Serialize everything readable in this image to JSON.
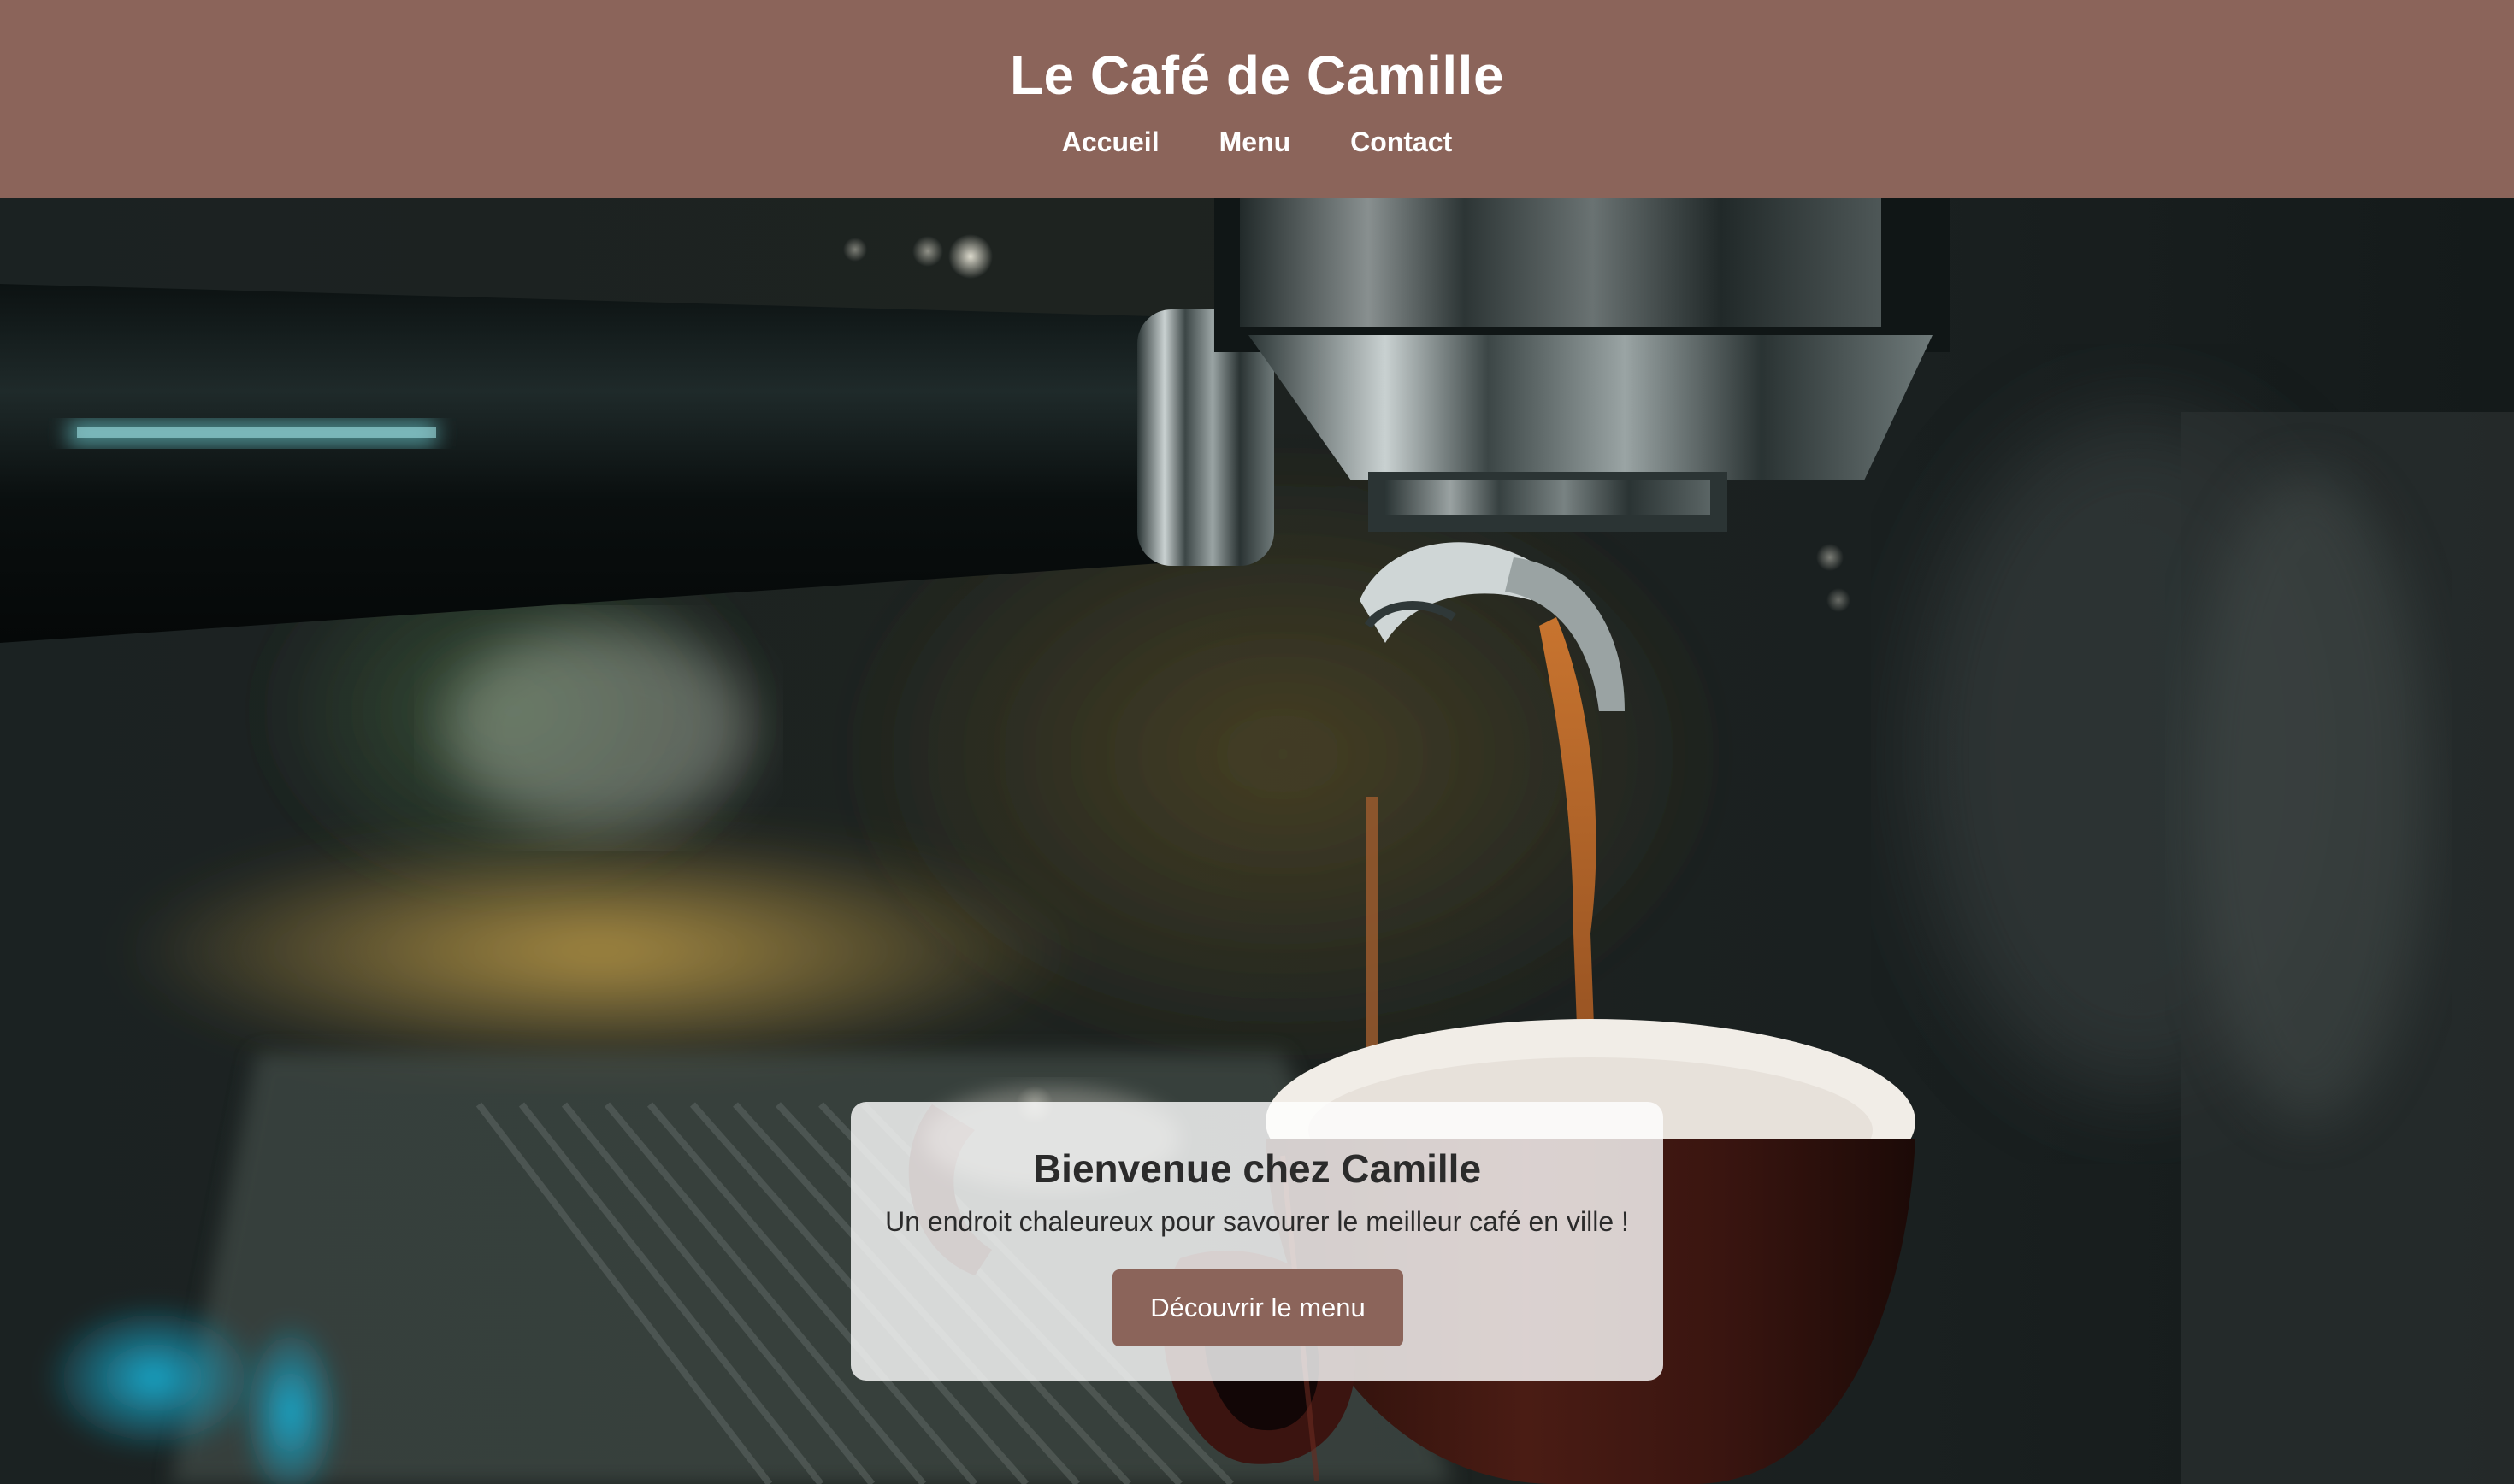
{
  "header": {
    "title": "Le Café de Camille",
    "nav": [
      {
        "label": "Accueil"
      },
      {
        "label": "Menu"
      },
      {
        "label": "Contact"
      }
    ]
  },
  "hero": {
    "image": "espresso-machine-photo",
    "card": {
      "title": "Bienvenue chez Camille",
      "text": "Un endroit chaleureux pour savourer le meilleur café en ville !",
      "button_label": "Découvrir le menu"
    }
  },
  "colors": {
    "brand": "#8b645a",
    "header_text": "#ffffff",
    "card_bg": "rgba(255,255,255,0.80)",
    "card_text": "#2b2b2b"
  }
}
